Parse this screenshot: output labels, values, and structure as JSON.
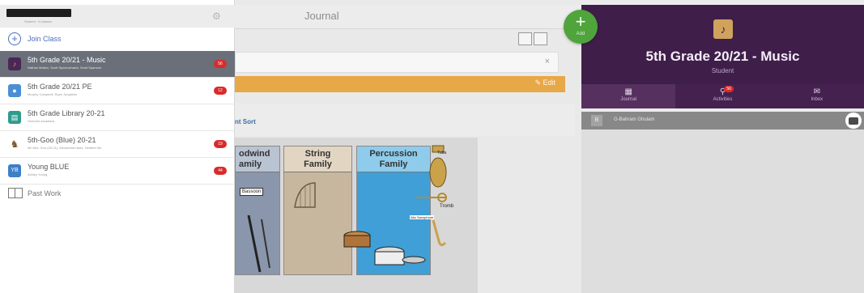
{
  "app": {
    "journal_title": "Journal"
  },
  "sidebar": {
    "account_subtitle": "Student · 5 classes",
    "join_class_label": "Join Class",
    "classes": [
      {
        "name": "5th Grade 20/21 - Music",
        "members": "Nathan Mattox, Scott Sparrowhawk, Scott Sparrow!",
        "badge": "56",
        "icon": "saxophone-icon",
        "icon_color": "#4b2757",
        "selected": true
      },
      {
        "name": "5th Grade 20/21 PE",
        "members": "Murphy Campbell, Ryan Jungblom",
        "badge": "12",
        "icon": "sports-icon",
        "icon_color": "#4a8fd6",
        "selected": false
      },
      {
        "name": "5th Grade Library 20-21",
        "members": "Vivienne Alcantara",
        "badge": "",
        "icon": "book-icon",
        "icon_color": "#2f9b8c",
        "selected": false
      },
      {
        "name": "5th-Goo (Blue) 20-21",
        "members": "5th Mrs. Goo (20-21), Alexandria Haas, Heather Ms",
        "badge": "19",
        "icon": "mascot-icon",
        "icon_color": "#ffffff",
        "selected": false
      },
      {
        "name": "Young BLUE",
        "members": "Ashley Young",
        "badge": "44",
        "icon": "initials-icon",
        "icon_text": "YB",
        "icon_color": "#3d7fc8",
        "selected": false
      }
    ],
    "past_work_label": "Past Work"
  },
  "main": {
    "search_clear": "×",
    "edit_label": "✎ Edit",
    "sort_label": "nt Sort",
    "post_image": {
      "families": {
        "woodwind": "odwind\namily",
        "string": "String\nFamily",
        "percussion": "Percussion\nFamily"
      },
      "labels": {
        "bassoon": "Bassoon",
        "tuba": "Tuba",
        "tromb": "Tromb",
        "saxophone": "Alto Saxophone"
      }
    }
  },
  "add_button": {
    "label": "Add"
  },
  "right_panel": {
    "header_title": "5th Grade 20/21 - Music",
    "header_subtitle": "Student",
    "header_color": "#3f1e4a",
    "tabs": [
      {
        "label": "Journal",
        "icon": "journal-icon"
      },
      {
        "label": "Activities",
        "icon": "activities-icon",
        "badge": "56"
      },
      {
        "label": "Inbox",
        "icon": "inbox-icon"
      }
    ],
    "student": {
      "initial": "B",
      "name": "G-Bahram Ghulam"
    }
  },
  "colors": {
    "accent_green": "#4fa43c",
    "badge_red": "#d92b2b",
    "banner_orange": "#e7a848"
  }
}
